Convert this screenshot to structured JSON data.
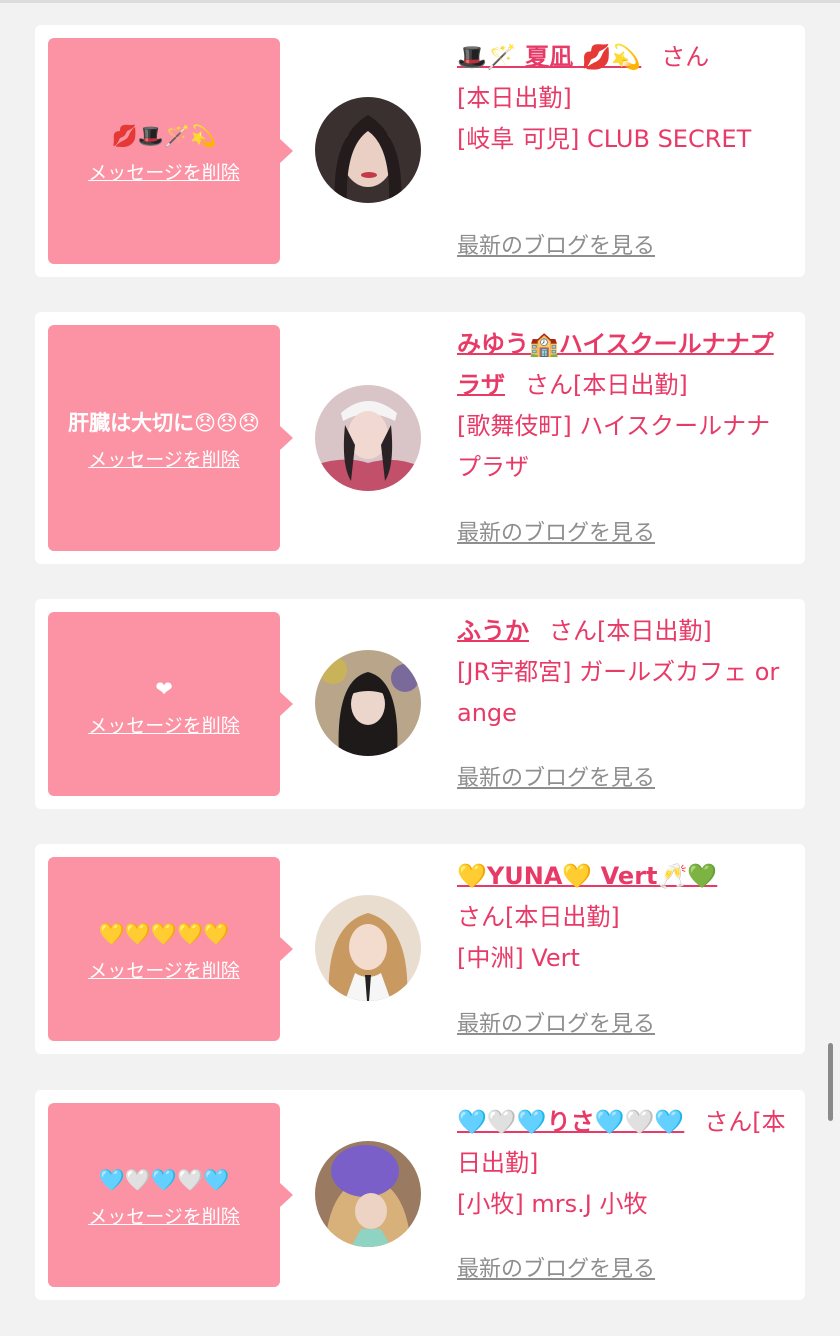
{
  "delete_label": "メッセージを削除",
  "blog_label": "最新のブログを見る",
  "san_label": "さん",
  "accent_color": "#e83a67",
  "bubble_color": "#fb93a5",
  "entries": [
    {
      "message": "💋🎩🪄💫",
      "name": "🎩🪄 夏凪 💋💫",
      "status": "[本日出勤]",
      "shop": "[岐阜 可児] CLUB SECRET"
    },
    {
      "message": "肝臓は大切に😞😞😞",
      "name": "みゆう🏫ハイスクールナナプラザ",
      "status": "[本日出勤]",
      "shop": "[歌舞伎町] ハイスクールナナプラザ"
    },
    {
      "message": "❤",
      "name": "ふうか",
      "status": "[本日出勤]",
      "shop": "[JR宇都宮] ガールズカフェ orange"
    },
    {
      "message": "💛💛💛💛💛",
      "name": "💛YUNA💛 Vert🥂💚",
      "status": "[本日出勤]",
      "shop": "[中洲] Vert"
    },
    {
      "message": "🩵🤍🩵🤍🩵",
      "name": "🩵🤍🩵りさ🩵🤍🩵",
      "status": "[本日出勤]",
      "shop": "[小牧] mrs.J 小牧"
    }
  ]
}
